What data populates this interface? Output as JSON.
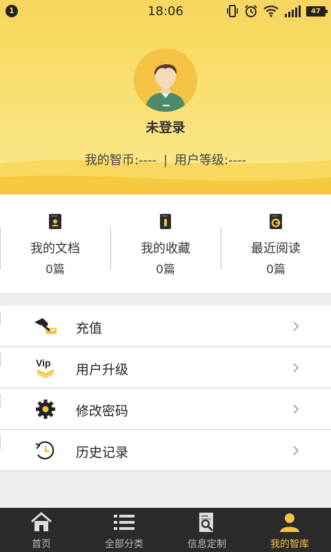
{
  "status_bar": {
    "notification_count": "1",
    "time": "18:06",
    "battery": "47",
    "icons": [
      "vibrate-icon",
      "alarm-icon",
      "wifi-icon",
      "signal-icon",
      "battery-icon"
    ]
  },
  "profile": {
    "username": "未登录",
    "coins_label": "我的智币:----",
    "separator": "|",
    "level_label": "用户等级:----"
  },
  "quick_items": [
    {
      "label": "我的文档",
      "count": "0篇",
      "icon": "document-icon"
    },
    {
      "label": "我的收藏",
      "count": "0篇",
      "icon": "favorite-icon"
    },
    {
      "label": "最近阅读",
      "count": "0篇",
      "icon": "recent-read-icon"
    }
  ],
  "menu": [
    {
      "label": "充值",
      "icon": "recharge-icon"
    },
    {
      "label": "用户升级",
      "icon": "vip-icon"
    },
    {
      "label": "修改密码",
      "icon": "gear-icon"
    },
    {
      "label": "历史记录",
      "icon": "history-icon"
    }
  ],
  "tabs": [
    {
      "label": "首页",
      "icon": "home-icon"
    },
    {
      "label": "全部分类",
      "icon": "list-icon"
    },
    {
      "label": "信息定制",
      "icon": "search-document-icon"
    },
    {
      "label": "我的智库",
      "icon": "user-icon",
      "active": true
    }
  ],
  "colors": {
    "accent": "#f5c243",
    "header": "#f8d95e",
    "tab_bar": "#2b2b2b"
  }
}
